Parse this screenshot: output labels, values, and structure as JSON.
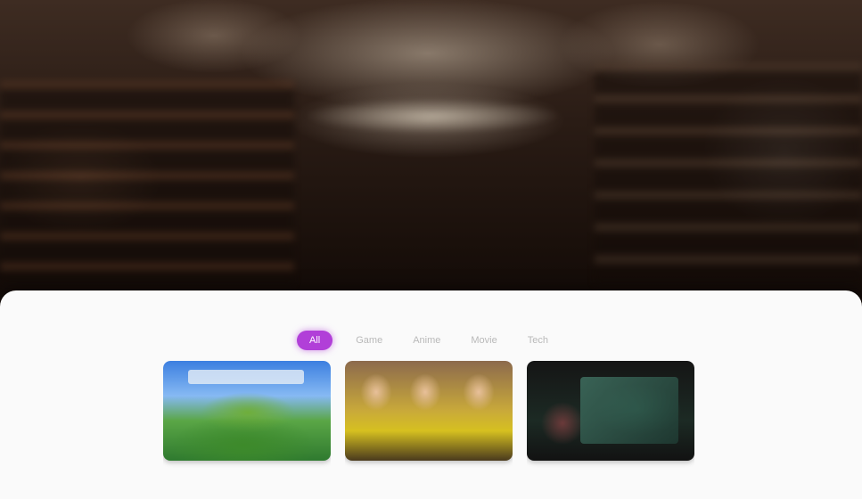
{
  "hero": {
    "image_alt": "Library hall"
  },
  "filters": {
    "tabs": [
      {
        "label": "All",
        "active": true
      },
      {
        "label": "Game"
      },
      {
        "label": "Anime"
      },
      {
        "label": "Movie"
      },
      {
        "label": "Tech"
      }
    ]
  },
  "cards": [
    {
      "image": "minecraft-thumbnail",
      "meta": "",
      "title": ""
    },
    {
      "image": "group-photo-thumbnail",
      "meta": "",
      "title": ""
    },
    {
      "image": "dark-scene-thumbnail",
      "meta": "",
      "title": ""
    }
  ],
  "colors": {
    "accent": "#b13fd8",
    "panel": "#fafafa",
    "hero_dark": "#120b08"
  }
}
